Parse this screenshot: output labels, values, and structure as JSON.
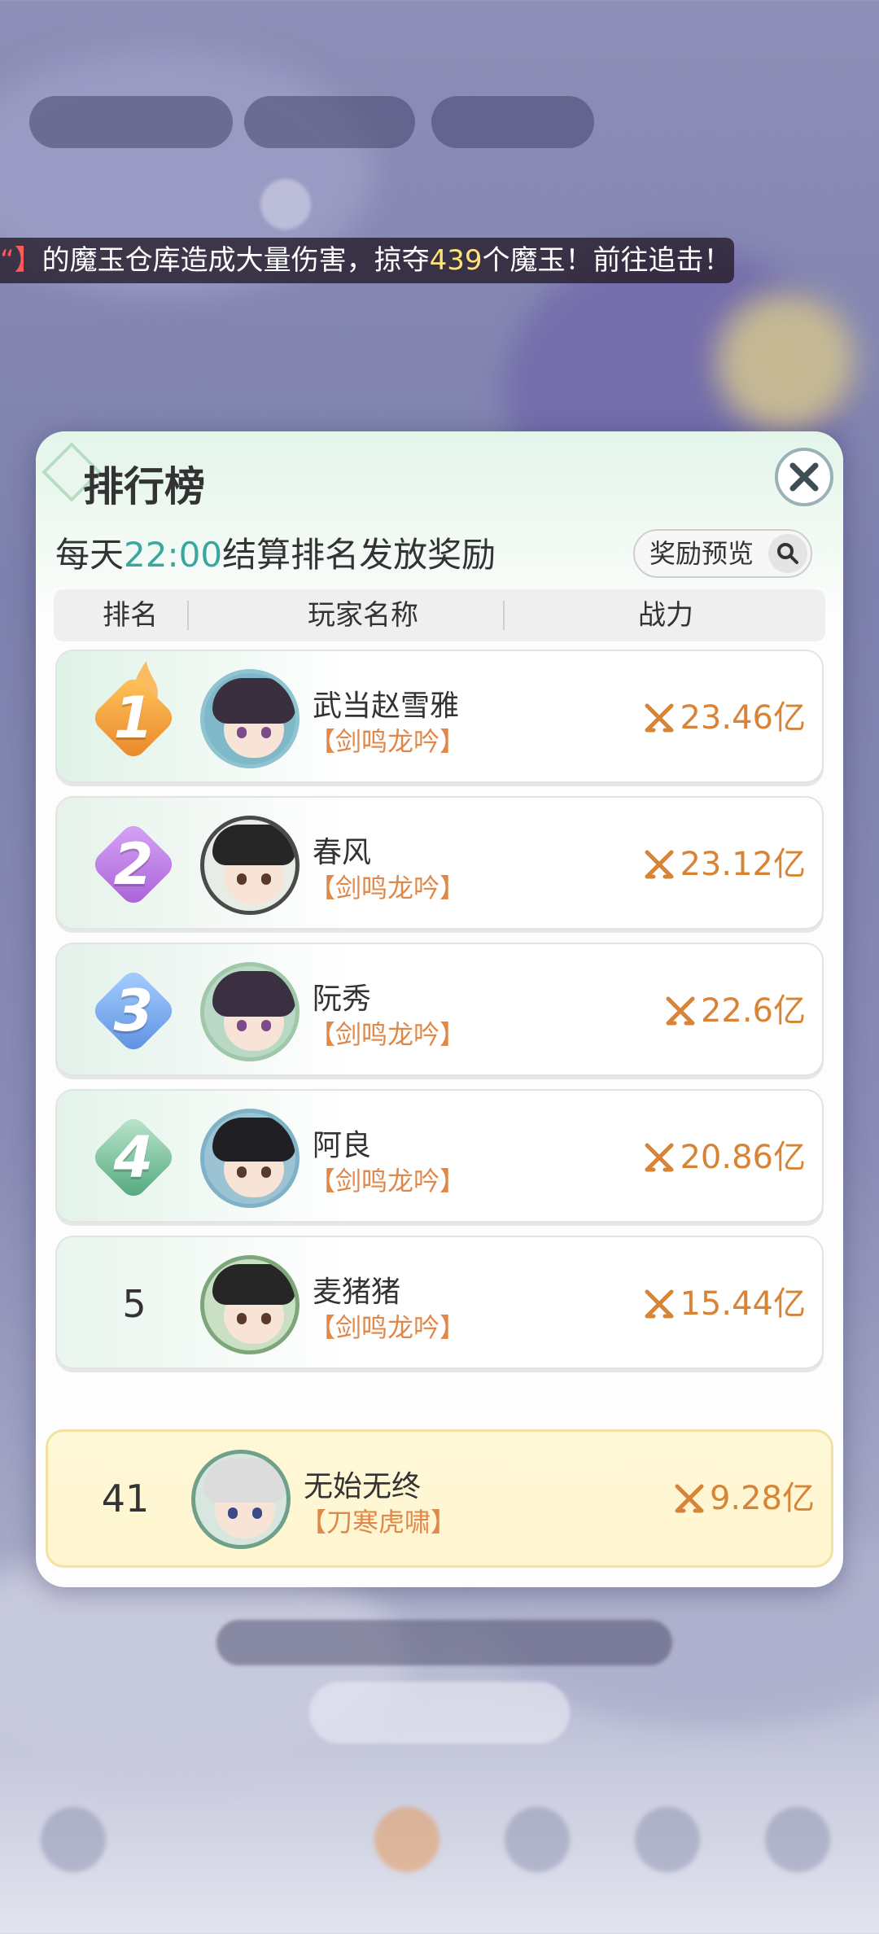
{
  "ticker": {
    "prefix": "“】",
    "text_before": "的魔玉仓库造成大量伤害，掠夺",
    "amount": "439",
    "text_after": "个魔玉！前往追击！"
  },
  "panel": {
    "title": "排行榜",
    "subtitle_prefix": "每天",
    "subtitle_time": "22:00",
    "subtitle_suffix": "结算排名发放奖励",
    "preview_button": "奖励预览",
    "columns": [
      "排名",
      "玩家名称",
      "战力"
    ]
  },
  "rows": [
    {
      "rank": "1",
      "name": "武当赵雪雅",
      "guild": "【剑鸣龙吟】",
      "power": "23.46亿"
    },
    {
      "rank": "2",
      "name": "春风",
      "guild": "【剑鸣龙吟】",
      "power": "23.12亿"
    },
    {
      "rank": "3",
      "name": "阮秀",
      "guild": "【剑鸣龙吟】",
      "power": "22.6亿"
    },
    {
      "rank": "4",
      "name": "阿良",
      "guild": "【剑鸣龙吟】",
      "power": "20.86亿"
    },
    {
      "rank": "5",
      "name": "麦猪猪",
      "guild": "【剑鸣龙吟】",
      "power": "15.44亿"
    }
  ],
  "self_row": {
    "rank": "41",
    "name": "无始无终",
    "guild": "【刀寒虎啸】",
    "power": "9.28亿"
  },
  "colors": {
    "gold_badge": "#f0a030",
    "silver_badge": "#b07ae0",
    "bronze_badge": "#6fa6ea",
    "rank4_badge": "#5fb58c",
    "power_text": "#d88436",
    "guild_text": "#e0884a",
    "time_text": "#3aa6a0"
  },
  "icons": {
    "close": "close-icon",
    "search": "search-icon",
    "power": "crossed-swords-icon"
  }
}
